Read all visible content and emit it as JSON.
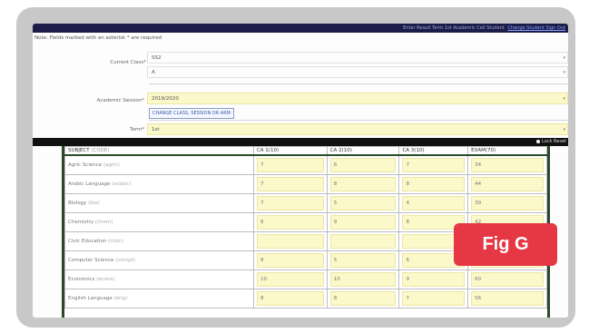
{
  "topbar": {
    "text": "Enter Result Term 1st Academic Cell Student",
    "link": "Change Student Sign Out"
  },
  "note": "Note: Fields marked with an asterisk * are required",
  "form": {
    "current_class_label": "Current Class*",
    "current_class_value": "SS2",
    "arm_value": "A",
    "academic_session_label": "Academic Session*",
    "academic_session_value": "2019/2020",
    "change_button": "CHANGE CLASS, SESSION OR ARM",
    "term_label": "Term*",
    "term_value": "1st"
  },
  "lock_reset": "Lock Reset",
  "table": {
    "headers": [
      "SUBJECT",
      "CA 1(10)",
      "CA 2(10)",
      "CA 3(10)",
      "EXAM(70)"
    ],
    "header_code": "(CODE)",
    "rows": [
      {
        "subject": "Agric Science",
        "code": "(agric)",
        "ca1": "7",
        "ca2": "6",
        "ca3": "7",
        "exam": "34"
      },
      {
        "subject": "Arabic Language",
        "code": "(arabic)",
        "ca1": "7",
        "ca2": "8",
        "ca3": "8",
        "exam": "44"
      },
      {
        "subject": "Biology",
        "code": "(bio)",
        "ca1": "7",
        "ca2": "5",
        "ca3": "4",
        "exam": "39"
      },
      {
        "subject": "Chemistry",
        "code": "(chem)",
        "ca1": "6",
        "ca2": "9",
        "ca3": "8",
        "exam": "42"
      },
      {
        "subject": "Civic Education",
        "code": "(civic)",
        "ca1": "",
        "ca2": "",
        "ca3": "",
        "exam": ""
      },
      {
        "subject": "Computer Science",
        "code": "(compt)",
        "ca1": "8",
        "ca2": "5",
        "ca3": "6",
        "exam": "40"
      },
      {
        "subject": "Economics",
        "code": "(econs)",
        "ca1": "10",
        "ca2": "10",
        "ca3": "9",
        "exam": "60"
      },
      {
        "subject": "English Language",
        "code": "(eng)",
        "ca1": "8",
        "ca2": "8",
        "ca3": "7",
        "exam": "56"
      }
    ]
  },
  "badge": "Fig G"
}
